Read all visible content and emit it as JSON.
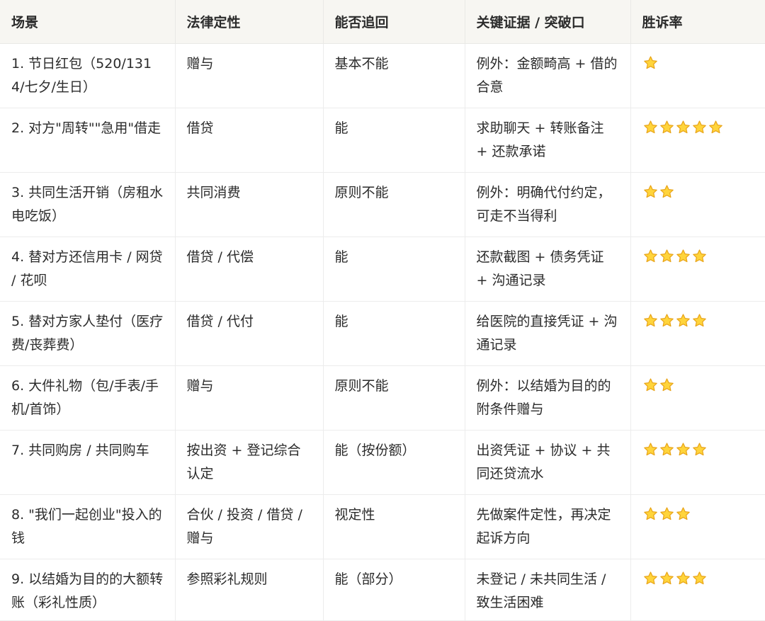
{
  "headers": [
    "场景",
    "法律定性",
    "能否追回",
    "关键证据 / 突破口",
    "胜诉率"
  ],
  "rows": [
    {
      "scene": "1. 节日红包（520/1314/七夕/生日）",
      "nature": "赠与",
      "recover": "基本不能",
      "evidence": "例外：金额畸高 + 借的合意",
      "rating": 1
    },
    {
      "scene": "2. 对方\"周转\"\"急用\"借走",
      "nature": "借贷",
      "recover": "能",
      "evidence": "求助聊天 + 转账备注 + 还款承诺",
      "rating": 5
    },
    {
      "scene": "3. 共同生活开销（房租水电吃饭）",
      "nature": "共同消费",
      "recover": "原则不能",
      "evidence": "例外：明确代付约定，可走不当得利",
      "rating": 2
    },
    {
      "scene": "4. 替对方还信用卡 / 网贷 / 花呗",
      "nature": "借贷 / 代偿",
      "recover": "能",
      "evidence": "还款截图 + 债务凭证 + 沟通记录",
      "rating": 4
    },
    {
      "scene": "5. 替对方家人垫付（医疗费/丧葬费）",
      "nature": "借贷 / 代付",
      "recover": "能",
      "evidence": "给医院的直接凭证 + 沟通记录",
      "rating": 4
    },
    {
      "scene": "6. 大件礼物（包/手表/手机/首饰）",
      "nature": "赠与",
      "recover": "原则不能",
      "evidence": "例外：以结婚为目的的附条件赠与",
      "rating": 2
    },
    {
      "scene": "7. 共同购房 / 共同购车",
      "nature": "按出资 + 登记综合认定",
      "recover": "能（按份额）",
      "evidence": "出资凭证 + 协议 + 共同还贷流水",
      "rating": 4
    },
    {
      "scene": "8. \"我们一起创业\"投入的钱",
      "nature": "合伙 / 投资 / 借贷 / 赠与",
      "recover": "视定性",
      "evidence": "先做案件定性，再决定起诉方向",
      "rating": 3
    },
    {
      "scene": "9. 以结婚为目的的大额转账（彩礼性质）",
      "nature": "参照彩礼规则",
      "recover": "能（部分）",
      "evidence": "未登记 / 未共同生活 / 致生活困难",
      "rating": 4
    }
  ],
  "colors": {
    "header_bg": "#f7f6f2",
    "border": "#ececec",
    "text": "#2b2b2b",
    "star_fill": "#ffd43b",
    "star_stroke": "#e8a317"
  },
  "icons": {
    "rating": "star-icon"
  }
}
